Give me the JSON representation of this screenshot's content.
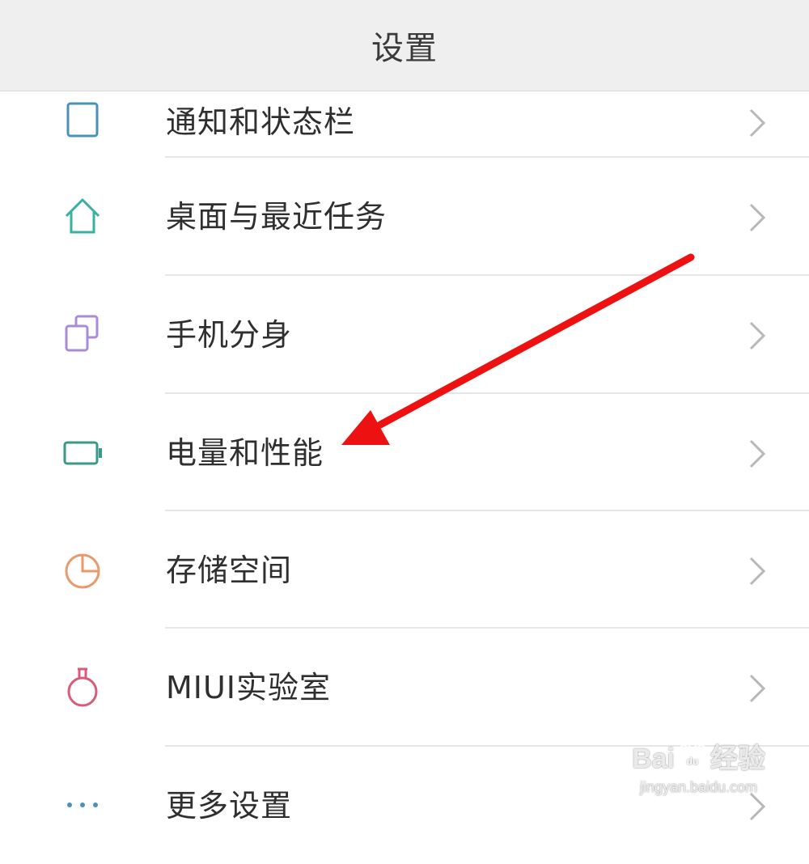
{
  "header": {
    "title": "设置"
  },
  "items": [
    {
      "label": "通知和状态栏",
      "icon": "notification-icon",
      "color": "#4a90b8"
    },
    {
      "label": "桌面与最近任务",
      "icon": "home-icon",
      "color": "#3ab0a0"
    },
    {
      "label": "手机分身",
      "icon": "clone-icon",
      "color": "#a98bd6"
    },
    {
      "label": "电量和性能",
      "icon": "battery-icon",
      "color": "#3a9a8a"
    },
    {
      "label": "存储空间",
      "icon": "storage-pie-icon",
      "color": "#e89a6a"
    },
    {
      "label": "MIUI实验室",
      "icon": "flask-icon",
      "color": "#d85c7a"
    },
    {
      "label": "更多设置",
      "icon": "more-dots-icon",
      "color": "#4a90b8"
    }
  ],
  "annotation": {
    "arrow_color": "#ee1111"
  },
  "watermark": {
    "line1_left": "Bai",
    "line1_right": "经验",
    "line2": "jingyan.baidu.com",
    "paw_text": "du"
  }
}
